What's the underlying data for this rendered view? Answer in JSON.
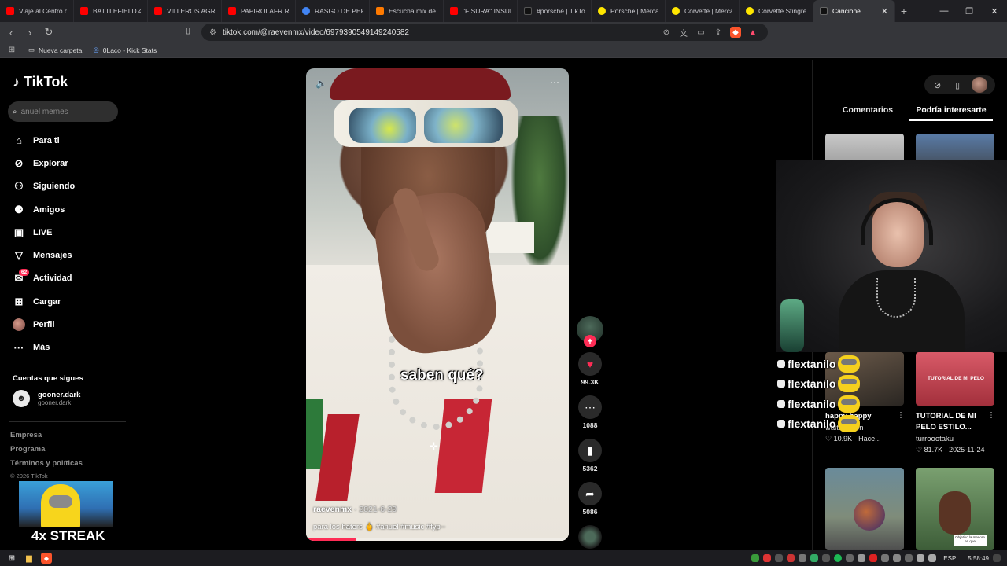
{
  "browser": {
    "tabs": [
      {
        "label": "Viaje al Centro de",
        "color": "#ff0000"
      },
      {
        "label": "BATTLEFIELD 4 R",
        "color": "#ff0000"
      },
      {
        "label": "VILLEROS AGRED",
        "color": "#ff0000"
      },
      {
        "label": "PAPIROLAFR RES",
        "color": "#ff0000"
      },
      {
        "label": "RASGO DE PERSC",
        "color": "#4285f4"
      },
      {
        "label": "Escucha mix de n",
        "color": "#ff7a00"
      },
      {
        "label": "\"FISURA\" INSULT",
        "color": "#ff0000"
      },
      {
        "label": "#porsche | TikTok",
        "color": "#111111"
      },
      {
        "label": "Porsche | Mercad",
        "color": "#ffe600"
      },
      {
        "label": "Corvette | Mercac",
        "color": "#ffe600"
      },
      {
        "label": "Corvette Stingrey",
        "color": "#ffe600"
      }
    ],
    "active_tab": {
      "label": "Cancione",
      "close": "✕"
    },
    "new_tab": "+",
    "window_controls": {
      "tab_search": "⌄",
      "minimize": "—",
      "maximize": "❐",
      "close": "✕"
    },
    "url": "tiktok.com/@raevenmx/video/6979390549149240582",
    "bookmarks": [
      {
        "label": "Nueva carpeta",
        "icon": "folder-icon"
      },
      {
        "label": "0Laco - Kick Stats",
        "icon": "kick-icon"
      }
    ]
  },
  "sidebar": {
    "brand": "TikTok",
    "search_placeholder": "anuel memes",
    "nav": [
      {
        "label": "Para ti",
        "icon": "home-icon",
        "glyph": "⌂"
      },
      {
        "label": "Explorar",
        "icon": "compass-icon",
        "glyph": "⊘"
      },
      {
        "label": "Siguiendo",
        "icon": "following-icon",
        "glyph": "⚇"
      },
      {
        "label": "Amigos",
        "icon": "friends-icon",
        "glyph": "⚉"
      },
      {
        "label": "LIVE",
        "icon": "live-icon",
        "glyph": "▣"
      },
      {
        "label": "Mensajes",
        "icon": "messages-icon",
        "glyph": "▽"
      },
      {
        "label": "Actividad",
        "icon": "activity-icon",
        "glyph": "✉",
        "badge": "62"
      },
      {
        "label": "Cargar",
        "icon": "upload-icon",
        "glyph": "⊞"
      },
      {
        "label": "Perfil",
        "icon": "profile-icon",
        "glyph": ""
      },
      {
        "label": "Más",
        "icon": "more-icon",
        "glyph": "···"
      }
    ],
    "following_title": "Cuentas que sigues",
    "following": [
      {
        "name": "gooner.dark",
        "handle": "gooner.dark"
      }
    ],
    "footer_links": [
      "Empresa",
      "Programa",
      "Términos y políticas"
    ],
    "copyright": "© 2026 TikTok"
  },
  "streak_overlay": {
    "text": "4x STREAK"
  },
  "video": {
    "caption_overlay": "saben qué?",
    "author": "raevenmx",
    "date": "· 2021-6-29",
    "description": "para los haters 🖕 #anuel #music #fyp--",
    "progress": 0.19
  },
  "actions": {
    "likes": "99.3K",
    "comments": "1088",
    "saves": "5362",
    "shares": "5086"
  },
  "right_panel": {
    "tabs": [
      "Comentarios",
      "Podría interesarte"
    ],
    "active_tab": "Podría interesarte",
    "cards": [
      {
        "title": "happy happy",
        "author": "waltuhgoon",
        "likes": "10.9K",
        "date": "Hace..."
      },
      {
        "title": "TUTORIAL DE MI PELO ESTILO...",
        "author": "turroootaku",
        "likes": "81.7K",
        "date": "2025-11-24",
        "thumb_text": "TUTORIAL DE MI PELO"
      }
    ],
    "bottom_thumb_caption": "Objetivo la menore en que"
  },
  "chat": {
    "lines": [
      "flextanilo",
      "flextanilo",
      "flextanilo",
      "flextanilo"
    ]
  },
  "taskbar": {
    "language": "ESP",
    "time": "5:58:49"
  }
}
